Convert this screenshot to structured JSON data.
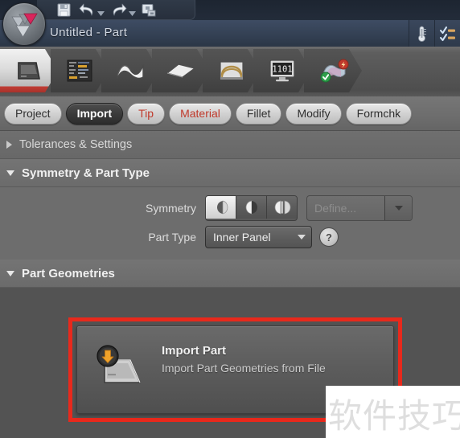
{
  "window": {
    "title": "Untitled - Part",
    "logo_icon": "triangles-logo-icon",
    "quick_access": [
      {
        "name": "save-icon",
        "label": "Save"
      },
      {
        "name": "undo-icon",
        "label": "Undo"
      },
      {
        "name": "undo-dropdown-icon",
        "label": "Undo history"
      },
      {
        "name": "redo-icon",
        "label": "Redo"
      },
      {
        "name": "redo-dropdown-icon",
        "label": "Redo history"
      },
      {
        "name": "screenshot-icon",
        "label": "Screenshot"
      }
    ],
    "right_buttons": [
      {
        "name": "thermometer-icon",
        "label": "Diagnostics"
      },
      {
        "name": "checklist-icon",
        "label": "Task list"
      }
    ]
  },
  "ribbon": {
    "items": [
      {
        "label": "Part",
        "icon": "part-panel-icon",
        "active": true
      },
      {
        "label": "Process",
        "icon": "process-tree-icon",
        "active": false
      },
      {
        "label": "Blank",
        "icon": "blank-surface-icon",
        "active": false
      },
      {
        "label": "Sheet",
        "icon": "sheet-plane-icon",
        "active": false
      },
      {
        "label": "Die",
        "icon": "die-tool-icon",
        "active": false
      },
      {
        "label": "Output",
        "icon": "monitor-1101-icon",
        "active": false
      },
      {
        "label": "Validate",
        "icon": "validate-flag-icon",
        "active": false
      }
    ]
  },
  "tabs": {
    "items": [
      {
        "label": "Project",
        "state": "normal"
      },
      {
        "label": "Import",
        "state": "selected"
      },
      {
        "label": "Tip",
        "state": "warn"
      },
      {
        "label": "Material",
        "state": "warn"
      },
      {
        "label": "Fillet",
        "state": "normal"
      },
      {
        "label": "Modify",
        "state": "normal"
      },
      {
        "label": "Formchk",
        "state": "normal"
      }
    ]
  },
  "sections": {
    "tolerances": {
      "title": "Tolerances & Settings",
      "expanded": false,
      "toggle_icon": "chevron-right-icon"
    },
    "symmetry": {
      "title": "Symmetry & Part Type",
      "expanded": true,
      "toggle_icon": "chevron-down-icon",
      "symmetry_label": "Symmetry",
      "symmetry_options": [
        {
          "name": "symmetry-none-icon",
          "selected": true
        },
        {
          "name": "symmetry-left-icon",
          "selected": false
        },
        {
          "name": "symmetry-right-icon",
          "selected": false
        }
      ],
      "define_button": "Define...",
      "define_enabled": false,
      "part_type_label": "Part Type",
      "part_type_value": "Inner Panel",
      "help_label": "?"
    },
    "part_geometries": {
      "title": "Part Geometries",
      "expanded": true,
      "toggle_icon": "chevron-down-icon",
      "card": {
        "icon": "import-part-icon",
        "title": "Import Part",
        "subtitle": "Import Part Geometries from File",
        "highlighted": true,
        "highlight_color": "#e8291c"
      }
    }
  },
  "watermark": {
    "text": "软件技巧"
  },
  "colors": {
    "accent_red": "#e8291c",
    "titlebar_blue": "#344154",
    "panel_gray": "#6b6b6b",
    "tab_selected_dark": "#3a3a3a",
    "warn_red_text": "#c0392b"
  }
}
